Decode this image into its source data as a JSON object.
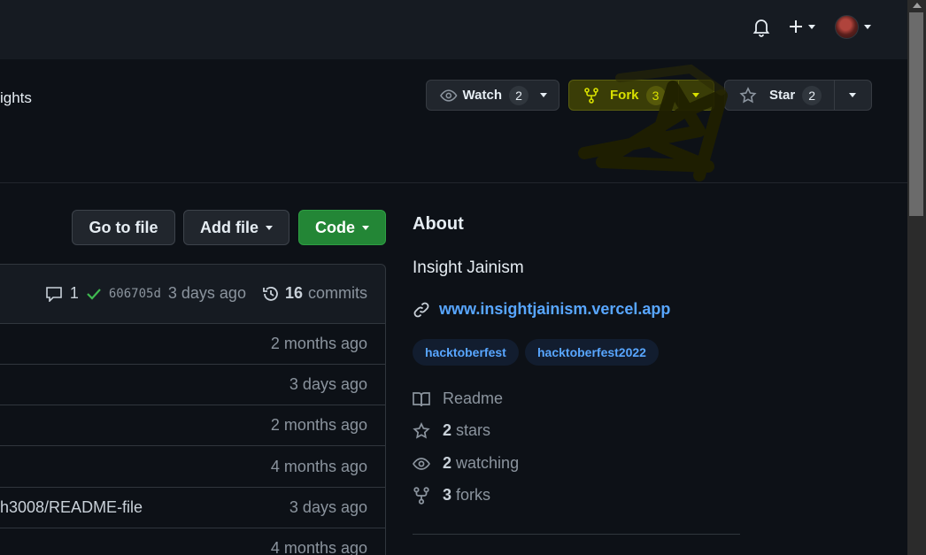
{
  "header": {
    "icons": [
      "bell-icon",
      "plus-icon",
      "avatar"
    ]
  },
  "repo_nav": {
    "insights_tab": "ights"
  },
  "repo_actions": {
    "watch": {
      "label": "Watch",
      "count": "2"
    },
    "fork": {
      "label": "Fork",
      "count": "3"
    },
    "star": {
      "label": "Star",
      "count": "2"
    }
  },
  "file_actions": {
    "go_to_file": "Go to file",
    "add_file": "Add file",
    "code": "Code"
  },
  "latest_commit": {
    "comments": "1",
    "sha": "606705d",
    "time": "3 days ago",
    "commits_count": "16",
    "commits_label": "commits"
  },
  "files": [
    {
      "message": "",
      "time": "2 months ago"
    },
    {
      "message": "",
      "time": "3 days ago"
    },
    {
      "message": "",
      "time": "2 months ago"
    },
    {
      "message": "",
      "time": "4 months ago"
    },
    {
      "message": "h3008/README-file",
      "time": "3 days ago"
    },
    {
      "message": "",
      "time": "4 months ago"
    }
  ],
  "about": {
    "title": "About",
    "description": "Insight Jainism",
    "website": "www.insightjainism.vercel.app",
    "topics": [
      "hacktoberfest",
      "hacktoberfest2022"
    ],
    "readme": "Readme",
    "stars_count": "2",
    "stars_label": "stars",
    "watching_count": "2",
    "watching_label": "watching",
    "forks_count": "3",
    "forks_label": "forks"
  },
  "colors": {
    "background": "#0d1117",
    "code_button": "#238636",
    "link": "#58a6ff",
    "fork_highlight": "#d8e000"
  }
}
